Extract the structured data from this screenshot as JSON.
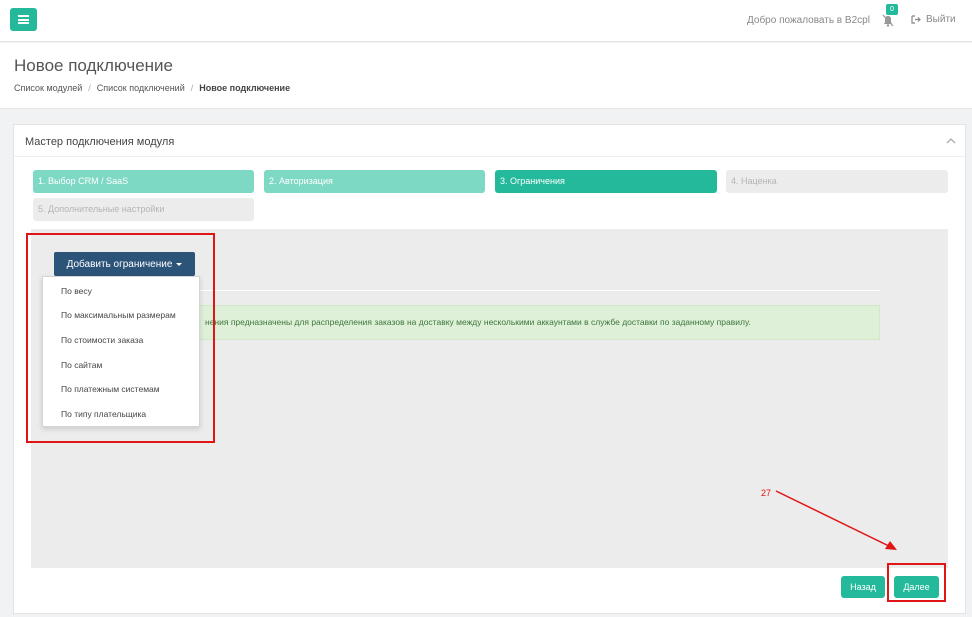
{
  "topbar": {
    "welcome": "Добро пожаловать в B2cpl",
    "notif_count": "0",
    "logout_label": "Выйти"
  },
  "page": {
    "title": "Новое подключение",
    "breadcrumb": [
      "Список модулей",
      "Список подключений",
      "Новое подключение"
    ]
  },
  "panel": {
    "title": "Мастер подключения модуля"
  },
  "steps": [
    {
      "label": "1. Выбор CRM / SaaS",
      "state": "done"
    },
    {
      "label": "2. Авторизация",
      "state": "done"
    },
    {
      "label": "3. Ограничения",
      "state": "current"
    },
    {
      "label": "4. Наценка",
      "state": "todo"
    },
    {
      "label": "5. Дополнительные настройки",
      "state": "todo"
    }
  ],
  "add_button": "Добавить ограничение",
  "dropdown": [
    "По весу",
    "По максимальным размерам",
    "По стоимости заказа",
    "По сайтам",
    "По платежным системам",
    "По типу плательщика"
  ],
  "alert": "нения предназначены для распределения заказов на доставку между несколькими аккаунтами в службе доставки по заданному правилу.",
  "buttons": {
    "back": "Назад",
    "next": "Далее"
  },
  "annotation": {
    "number": "27",
    "color": "#e01515"
  },
  "colors": {
    "accent": "#23b99a",
    "step_done": "#7dd8c4",
    "primary_dark": "#2c5378",
    "alert_bg": "#dff0d8"
  }
}
